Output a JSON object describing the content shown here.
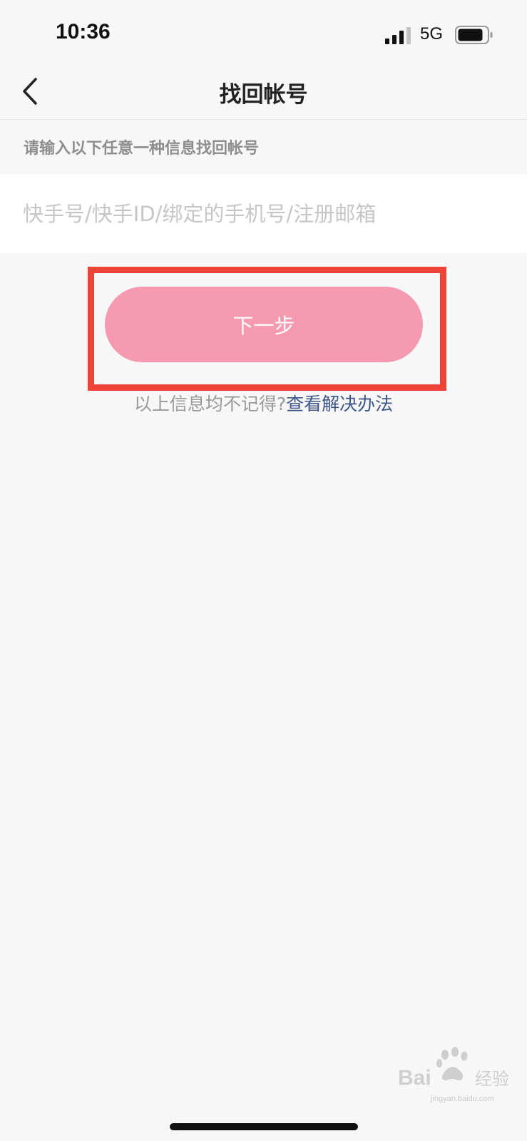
{
  "status_bar": {
    "time": "10:36",
    "network": "5G",
    "icons": [
      "signal-icon",
      "battery-icon"
    ]
  },
  "nav": {
    "back_icon": "chevron-left-icon",
    "title": "找回帐号"
  },
  "form": {
    "hint": "请输入以下任意一种信息找回帐号",
    "account_input": {
      "value": "",
      "placeholder": "快手号/快手ID/绑定的手机号/注册邮箱"
    },
    "next_button_label": "下一步"
  },
  "help": {
    "prefix": "以上信息均不记得?",
    "link": "查看解决办法"
  },
  "colors": {
    "button_bg": "#f59ab0",
    "highlight_border": "#ee4437",
    "link": "#3d5687",
    "background": "#f7f7f7"
  },
  "watermark": {
    "brand": "Bai",
    "brand_tail": "经验",
    "sub": "jingyan.baidu.com"
  }
}
